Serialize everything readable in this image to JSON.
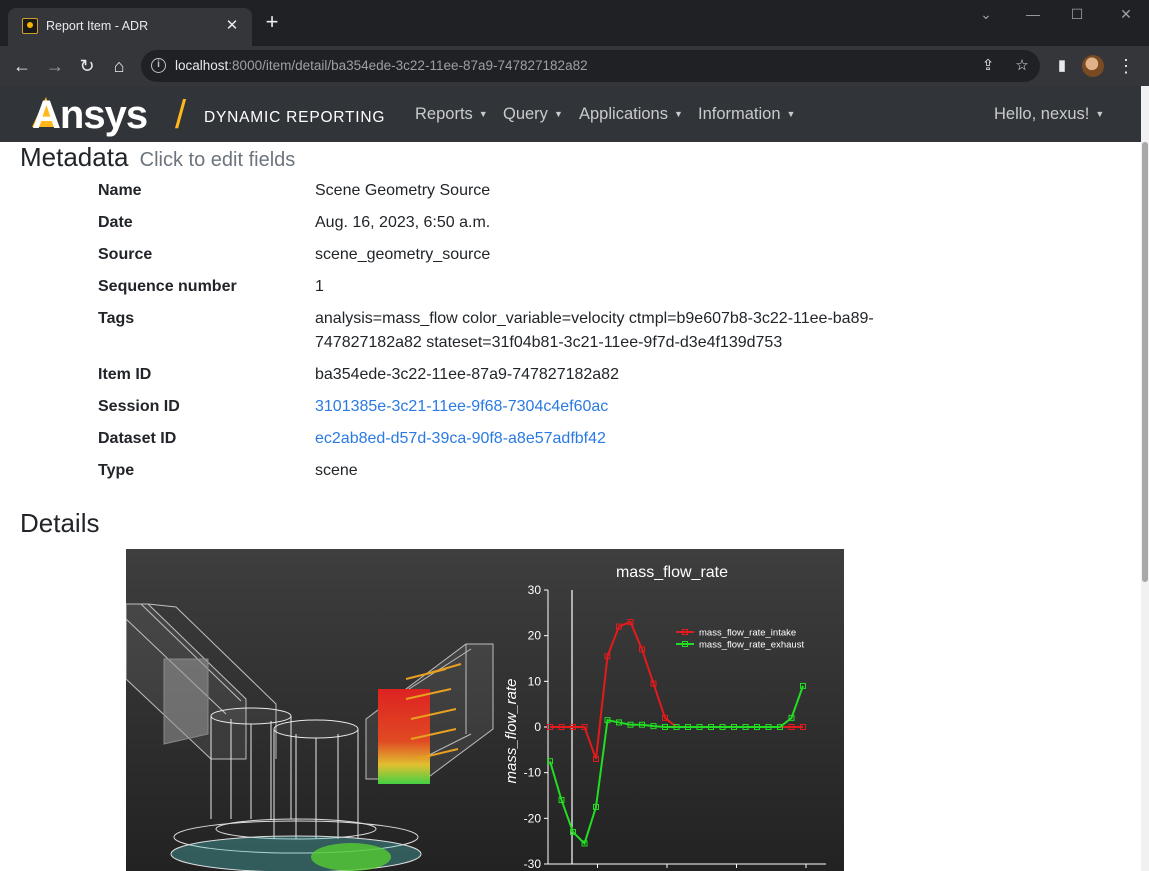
{
  "browser": {
    "tab_title": "Report Item - ADR",
    "url_host": "localhost",
    "url_rest": ":8000/item/detail/ba354ede-3c22-11ee-87a9-747827182a82"
  },
  "navbar": {
    "logo_text": "Ansys",
    "logo_sub": "DYNAMIC REPORTING",
    "menus": [
      "Reports",
      "Query",
      "Applications",
      "Information"
    ],
    "user": "Hello, nexus!"
  },
  "metadata": {
    "heading": "Metadata",
    "heading_sub": "Click to edit fields",
    "rows": [
      {
        "label": "Name",
        "value": "Scene Geometry Source"
      },
      {
        "label": "Date",
        "value": "Aug. 16, 2023, 6:50 a.m."
      },
      {
        "label": "Source",
        "value": "scene_geometry_source"
      },
      {
        "label": "Sequence number",
        "value": "1"
      },
      {
        "label": "Tags",
        "value": "analysis=mass_flow color_variable=velocity ctmpl=b9e607b8-3c22-11ee-ba89-747827182a82 stateset=31f04b81-3c21-11ee-9f7d-d3e4f139d753"
      },
      {
        "label": "Item ID",
        "value": "ba354ede-3c22-11ee-87a9-747827182a82"
      },
      {
        "label": "Session ID",
        "value": "3101385e-3c21-11ee-9f68-7304c4ef60ac"
      },
      {
        "label": "Dataset ID",
        "value": "ec2ab8ed-d57d-39ca-90f8-a8e57adfbf42"
      },
      {
        "label": "Type",
        "value": "scene"
      }
    ]
  },
  "details": {
    "heading": "Details"
  },
  "chart_data": {
    "type": "line",
    "title": "mass_flow_rate",
    "ylabel": "mass_flow_rate",
    "xlabel": "",
    "ylim": [
      -30,
      30
    ],
    "yticks": [
      30,
      20,
      10,
      0,
      -10,
      -20,
      -30
    ],
    "legend": "top-right",
    "series": [
      {
        "name": "mass_flow_rate_intake",
        "color": "#e41a1c",
        "values": [
          0,
          0,
          0,
          0,
          -7,
          15.5,
          22,
          23,
          17,
          9.5,
          2,
          0,
          0,
          0,
          0,
          0,
          0,
          0,
          0,
          0,
          0,
          0,
          0
        ]
      },
      {
        "name": "mass_flow_rate_exhaust",
        "color": "#22dd22",
        "values": [
          -7.5,
          -16,
          -23,
          -25.5,
          -17.5,
          1.5,
          1,
          0.5,
          0.5,
          0.2,
          0,
          0,
          0,
          0,
          0,
          0,
          0,
          0,
          0,
          0,
          0,
          2,
          9
        ]
      }
    ]
  }
}
